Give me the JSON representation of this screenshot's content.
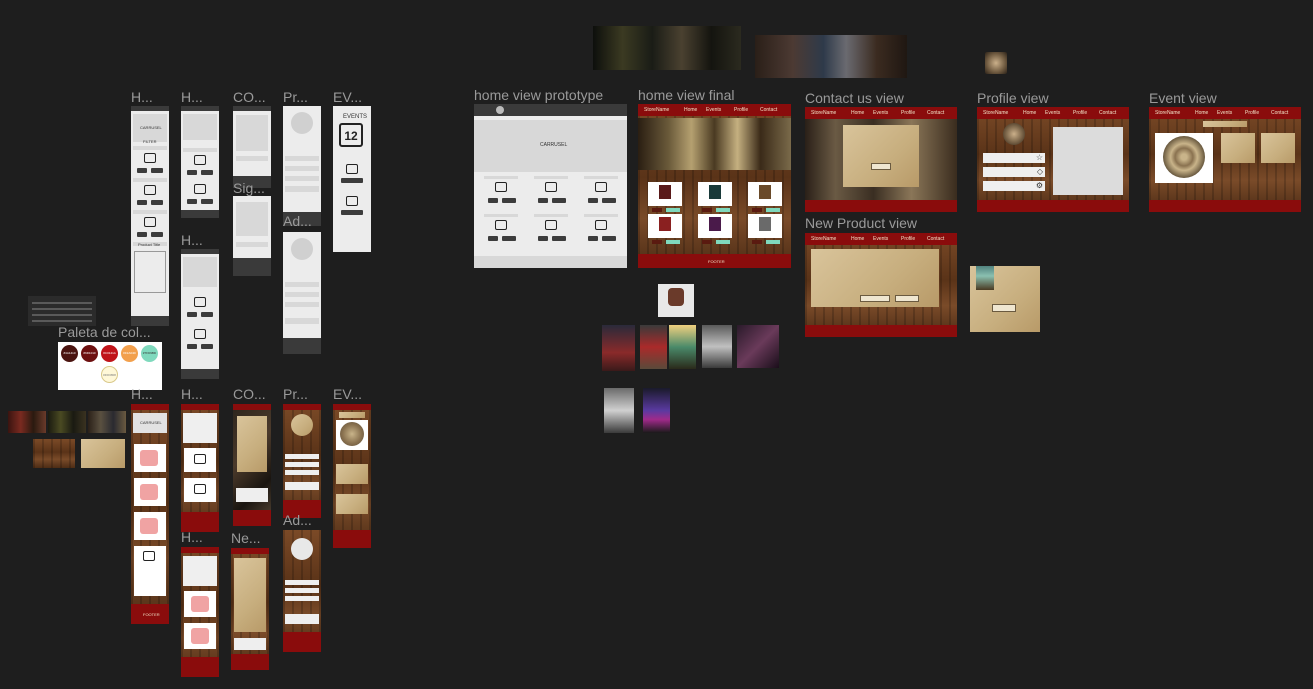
{
  "labels": {
    "m_home1": "H...",
    "m_home2": "H...",
    "m_contact": "CO...",
    "m_profile": "Pr...",
    "m_event": "EV...",
    "m_signup": "Sig...",
    "m_add": "Ad...",
    "m_home3": "H...",
    "palette": "Paleta de col...",
    "f_home1": "H...",
    "f_home2": "H...",
    "f_contact": "CO...",
    "f_profile": "Pr...",
    "f_event": "EV...",
    "f_add": "Ad...",
    "f_home3": "H...",
    "f_new": "Ne...",
    "home_proto": "home view prototype",
    "home_final": "home view final",
    "contact_view": "Contact us view",
    "profile_view": "Profile view",
    "event_view": "Event view",
    "new_product_view": "New Product view"
  },
  "wireframe_text": {
    "carousel": "CARRUSEL",
    "filter": "FILTER",
    "events": "EVENTS",
    "calendar_day": "12",
    "product_title": "Product Title",
    "footer": "FOOTER"
  },
  "nav": {
    "items": [
      "Home",
      "Events",
      "Profile",
      "Contact"
    ],
    "brand": "StoreName"
  },
  "palette": {
    "colors": [
      "#4a1410",
      "#6d1010",
      "#c0141a",
      "#f2a04d",
      "#7fd9bd",
      "#fff8d8"
    ],
    "names": [
      "#4A1410",
      "#6D1010",
      "#C0141A",
      "#F2A04D",
      "#7FD9BD",
      "#FFF8D8"
    ]
  },
  "accent": {
    "header_red": "#8a0c0c",
    "canvas": "#1e1e1e",
    "label_gray": "#9a9a9a"
  }
}
